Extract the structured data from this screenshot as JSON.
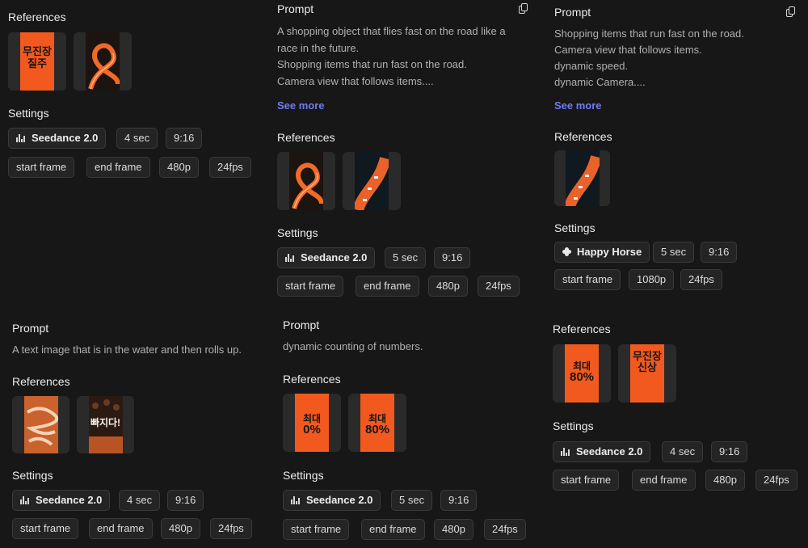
{
  "labels": {
    "prompt": "Prompt",
    "references": "References",
    "settings": "Settings",
    "see_more": "See more"
  },
  "icons": {
    "copy": "copy-icon",
    "model_bars": "bar-chart-icon",
    "model_flower": "flower-icon"
  },
  "colors": {
    "background": "#171717",
    "accent_link": "#6e7cf0",
    "poster_orange": "#f2591f"
  },
  "cards": [
    {
      "references": [
        {
          "kind": "poster",
          "text": "무진장 질주"
        },
        {
          "kind": "loop"
        }
      ],
      "settings": {
        "model": "Seedance 2.0",
        "duration": "4 sec",
        "ratio": "9:16",
        "start_frame": "start frame",
        "end_frame": "end frame",
        "resolution": "480p",
        "fps": "24fps"
      }
    },
    {
      "prompt_lines": [
        "A shopping object that flies fast on the road like a",
        "race in the future.",
        "Shopping items that run fast on the road.",
        "Camera view that follows items...."
      ],
      "references": [
        {
          "kind": "loop"
        },
        {
          "kind": "road"
        }
      ],
      "settings": {
        "model": "Seedance 2.0",
        "duration": "5 sec",
        "ratio": "9:16",
        "start_frame": "start frame",
        "end_frame": "end frame",
        "resolution": "480p",
        "fps": "24fps"
      }
    },
    {
      "prompt_lines": [
        "Shopping items that run fast on the road.",
        "Camera view that follows items.",
        "dynamic speed.",
        "dynamic Camera...."
      ],
      "references": [
        {
          "kind": "road"
        }
      ],
      "settings": {
        "model": "Happy Horse",
        "duration": "5 sec",
        "ratio": "9:16",
        "start_frame": "start frame",
        "resolution": "1080p",
        "fps": "24fps"
      }
    },
    {
      "prompt_lines": [
        "A text image that is in the water and then rolls up."
      ],
      "references": [
        {
          "kind": "water"
        },
        {
          "kind": "crowd",
          "text": "빠지다!"
        }
      ],
      "settings": {
        "model": "Seedance 2.0",
        "duration": "4 sec",
        "ratio": "9:16",
        "start_frame": "start frame",
        "end_frame": "end frame",
        "resolution": "480p",
        "fps": "24fps"
      }
    },
    {
      "prompt_lines": [
        "dynamic counting of numbers."
      ],
      "references": [
        {
          "kind": "percent",
          "line1": "최대",
          "line2": "0%"
        },
        {
          "kind": "percent",
          "line1": "최대",
          "line2": "80%"
        }
      ],
      "settings": {
        "model": "Seedance 2.0",
        "duration": "5 sec",
        "ratio": "9:16",
        "start_frame": "start frame",
        "end_frame": "end frame",
        "resolution": "480p",
        "fps": "24fps"
      }
    },
    {
      "references": [
        {
          "kind": "percent",
          "line1": "최대",
          "line2": "80%"
        },
        {
          "kind": "poster",
          "text": "무진장 신상"
        }
      ],
      "settings": {
        "model": "Seedance 2.0",
        "duration": "4 sec",
        "ratio": "9:16",
        "start_frame": "start frame",
        "end_frame": "end frame",
        "resolution": "480p",
        "fps": "24fps"
      }
    }
  ]
}
